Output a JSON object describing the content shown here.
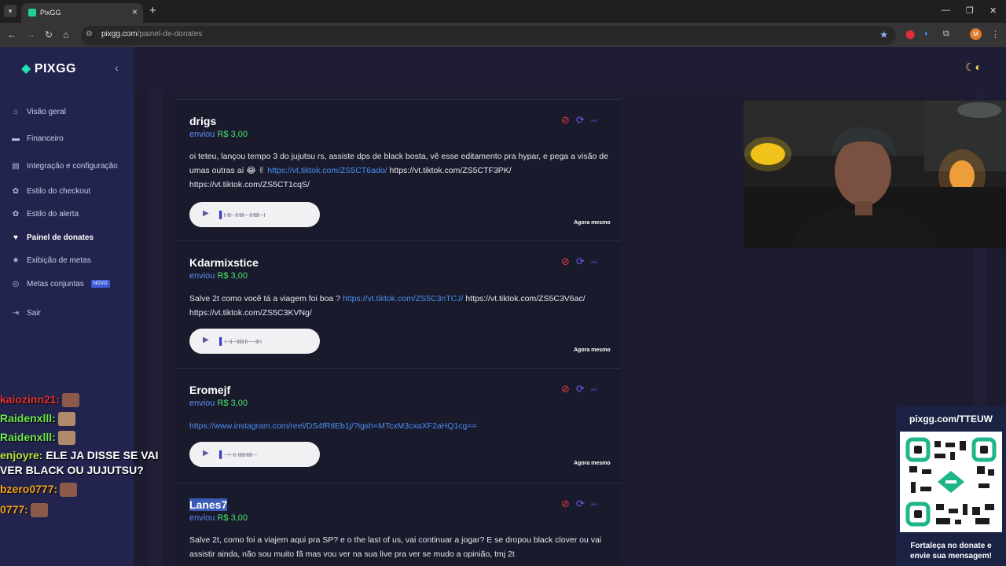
{
  "browser": {
    "tab_title": "PixGG",
    "url_host": "pixgg.com",
    "url_path": "/painel-de-donates",
    "profile_initial": "M"
  },
  "sidebar": {
    "brand": "PIXGG",
    "items": [
      {
        "label": "Visão geral",
        "icon": "home-icon"
      },
      {
        "label": "Financeiro",
        "icon": "wallet-icon"
      },
      {
        "label": "Integração e configuração",
        "icon": "settings-icon"
      },
      {
        "label": "Estilo do checkout",
        "icon": "palette-icon"
      },
      {
        "label": "Estilo do alerta",
        "icon": "palette-icon"
      },
      {
        "label": "Painel de donates",
        "icon": "donate-icon",
        "active": true
      },
      {
        "label": "Exibição de metas",
        "icon": "star-icon"
      },
      {
        "label": "Metas conjuntas",
        "icon": "goal-icon",
        "badge": "NOVO"
      },
      {
        "label": "Sair",
        "icon": "logout-icon"
      }
    ]
  },
  "donates": [
    {
      "name": "drigs",
      "sent_prefix": "enviou",
      "amount": "R$ 3,00",
      "message_text": "oi teteu, lançou tempo 3 do jujutsu rs, assiste dps de black bosta, vê esse editamento pra hypar, e pega a visão de umas outras aí 😂 ✌",
      "link": "https://vt.tiktok.com/ZS5CT6ado/",
      "message_tail": "https://vt.tiktok.com/ZS5CTF3PK/ https://vt.tiktok.com/ZS5CT1cqS/",
      "time": "Agora mesmo"
    },
    {
      "name": "Kdarmixstice",
      "sent_prefix": "enviou",
      "amount": "R$ 3,00",
      "message_text": "Salve 2t como você tá a viagem foi boa ?",
      "link": "https://vt.tiktok.com/ZS5C3nTCJ/",
      "message_tail": "https://vt.tiktok.com/ZS5C3V6ac/ https://vt.tiktok.com/ZS5C3KVNg/",
      "time": "Agora mesmo"
    },
    {
      "name": "Eromejf",
      "sent_prefix": "enviou",
      "amount": "R$ 3,00",
      "message_text": "",
      "link": "https://www.instagram.com/reel/DS4fRtlEb1j/?igsh=MTcxM3cxaXF2aHQ1cg==",
      "message_tail": "",
      "time": "Agora mesmo"
    },
    {
      "name": "Lanes7",
      "sent_prefix": "enviou",
      "amount": "R$ 3,00",
      "message_text": "Salve 2t, como foi a viajem aqui pra SP? e o the last of us, vai continuar a jogar? E se dropou black clover ou vai assistir ainda, não sou muito fã mas vou ver na sua live pra ver se mudo a opinião, tmj 2t",
      "link": "",
      "message_tail": "",
      "time": ""
    }
  ],
  "chat": [
    {
      "user": "kaiozinn21:",
      "text": "",
      "color": "#e0312f"
    },
    {
      "user": "Raidenxlll:",
      "text": "",
      "color": "#6ee84a"
    },
    {
      "user": "Raidenxlll:",
      "text": "",
      "color": "#6ee84a"
    },
    {
      "user": "enjoyre:",
      "text": "ELE JA DISSE SE VAI",
      "color": "#b6e43e"
    },
    {
      "user": "",
      "text": "VER BLACK OU JUJUTSU?",
      "color": "#ffffff"
    },
    {
      "user": "bzero0777:",
      "text": "",
      "color": "#f5a21a"
    },
    {
      "user": "0777:",
      "text": "",
      "color": "#f5a21a"
    }
  ],
  "qr_panel": {
    "url": "pixgg.com/TTEUW",
    "caption_line1": "Fortaleça no donate e",
    "caption_line2": "envie sua mensagem!"
  }
}
